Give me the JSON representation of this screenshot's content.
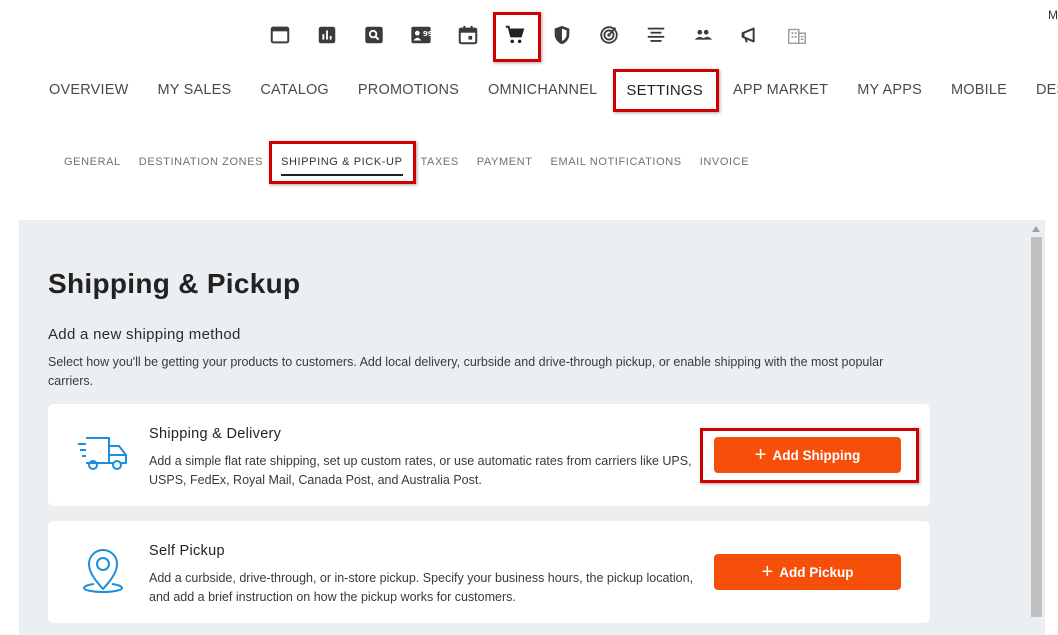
{
  "corner_text": "M",
  "icon_bar": [
    {
      "icon": "window-icon",
      "selected": false
    },
    {
      "icon": "bar-chart-icon",
      "selected": false
    },
    {
      "icon": "search-box-icon",
      "selected": false
    },
    {
      "icon": "testimonial-icon",
      "selected": false
    },
    {
      "icon": "calendar-icon",
      "selected": false
    },
    {
      "icon": "cart-icon",
      "selected": true
    },
    {
      "icon": "shield-icon",
      "selected": false
    },
    {
      "icon": "target-icon",
      "selected": false
    },
    {
      "icon": "align-center-icon",
      "selected": false
    },
    {
      "icon": "people-icon",
      "selected": false
    },
    {
      "icon": "megaphone-icon",
      "selected": false
    },
    {
      "icon": "building-icon",
      "selected": false
    }
  ],
  "main_nav": {
    "overview": "OVERVIEW",
    "my_sales": "MY SALES",
    "catalog": "CATALOG",
    "promotions": "PROMOTIONS",
    "omnichannel": "OMNICHANNEL",
    "settings": "SETTINGS",
    "app_market": "APP MARKET",
    "my_apps": "MY APPS",
    "mobile": "MOBILE",
    "design": "DESIGN"
  },
  "sub_nav": {
    "general": "GENERAL",
    "destination_zones": "DESTINATION ZONES",
    "shipping_pickup": "SHIPPING & PICK-UP",
    "taxes": "TAXES",
    "payment": "PAYMENT",
    "email_notifications": "EMAIL NOTIFICATIONS",
    "invoice": "INVOICE"
  },
  "page": {
    "title": "Shipping & Pickup",
    "section_title": "Add a new shipping method",
    "section_desc": "Select how you'll be getting your products to customers. Add local delivery, curbside and drive-through pickup, or enable shipping with the most popular carriers."
  },
  "cards": {
    "shipping": {
      "title": "Shipping & Delivery",
      "desc": "Add a simple flat rate shipping, set up custom rates, or use automatic rates from carriers like UPS, USPS, FedEx, Royal Mail, Canada Post, and Australia Post.",
      "button": "Add Shipping"
    },
    "pickup": {
      "title": "Self Pickup",
      "desc": "Add a curbside, drive-through, or in-store pickup. Specify your business hours, the pickup location, and add a brief instruction on how the pickup works for customers.",
      "button": "Add Pickup"
    }
  },
  "colors": {
    "accent": "#f64f0a",
    "highlight_box": "#d10000",
    "icon_blue": "#1b8fdb",
    "panel_bg": "#eceff2"
  }
}
